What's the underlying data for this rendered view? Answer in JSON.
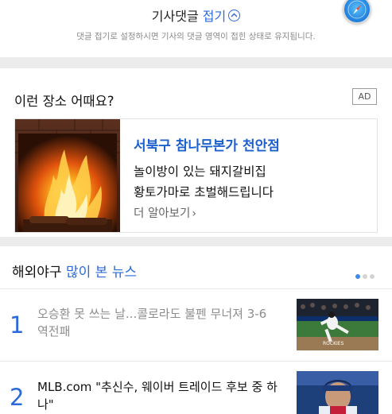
{
  "comment_fold": {
    "title": "기사댓글",
    "action": "접기",
    "description": "댓글 접기로 설정하시면 기사의 댓글 영역이 접힌 상태로 유지됩니다."
  },
  "ad": {
    "heading": "이런 장소 어때요?",
    "badge": "AD",
    "place_name": "서북구 참나무본가 천안점",
    "line1": "놀이방이 있는 돼지갈비집",
    "line2": "황토가마로 초벌해드립니다",
    "more": "더 알아보기",
    "thumbnail_icon": "fireplace-image"
  },
  "news": {
    "category": "해외야구",
    "section": "많이 본 뉴스",
    "page_dots": 3,
    "active_dot": 0,
    "items": [
      {
        "rank": "1",
        "title": "오승환 못 쓰는 날...콜로라도 불펜 무너져 3-6 역전패",
        "read": true,
        "image": "baseball-pitcher-photo"
      },
      {
        "rank": "2",
        "title": "MLB.com \"추신수, 웨이버 트레이드 후보 중 하나\"",
        "read": false,
        "image": "baseball-player-photo"
      }
    ]
  },
  "colors": {
    "accent": "#2b6ad8",
    "ad_title": "#1d5fcc",
    "read_text": "#8e8e8e"
  }
}
